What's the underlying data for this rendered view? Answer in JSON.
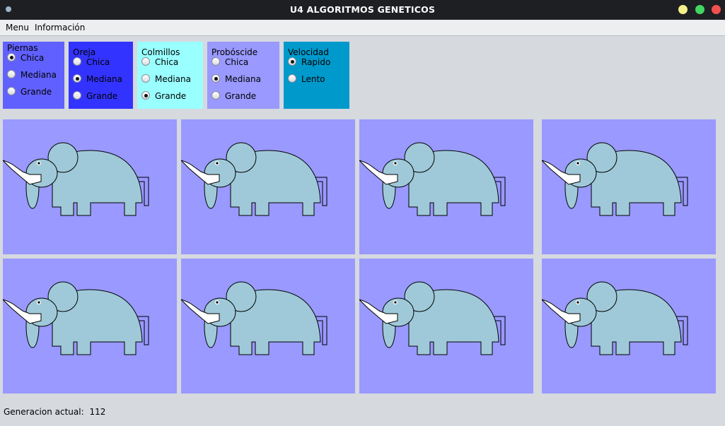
{
  "window": {
    "title": "U4  ALGORITMOS GENETICOS",
    "controls": [
      {
        "name": "minimize",
        "color": "#f4f08a"
      },
      {
        "name": "maximize",
        "color": "#43d660"
      },
      {
        "name": "close",
        "color": "#f25050"
      }
    ]
  },
  "menubar": {
    "items": [
      "Menu",
      "Información"
    ]
  },
  "panels": [
    {
      "key": "piernas",
      "title": "Piernas",
      "bg": "#6060ff",
      "options": [
        "Chica",
        "Mediana",
        "Grande"
      ],
      "selected": 0
    },
    {
      "key": "oreja",
      "title": "Oreja",
      "bg": "#3333ff",
      "options": [
        "Chica",
        "Mediana",
        "Grande"
      ],
      "selected": 1
    },
    {
      "key": "colmillos",
      "title": "Colmillos",
      "bg": "#99ffff",
      "options": [
        "Chica",
        "Mediana",
        "Grande"
      ],
      "selected": 2
    },
    {
      "key": "proboscide",
      "title": "Probóscide",
      "bg": "#9999ff",
      "options": [
        "Chica",
        "Mediana",
        "Grande"
      ],
      "selected": 1
    },
    {
      "key": "velocidad",
      "title": "Velocidad",
      "bg": "#0099cc",
      "options": [
        "Rapido",
        "Lento"
      ],
      "selected": 0
    }
  ],
  "grid": {
    "rows": 2,
    "cols": 4,
    "cell_bg": "#9999ff",
    "elephant_color": "#9fc9d8"
  },
  "status": {
    "label": "Generacion actual:",
    "value": "112"
  }
}
